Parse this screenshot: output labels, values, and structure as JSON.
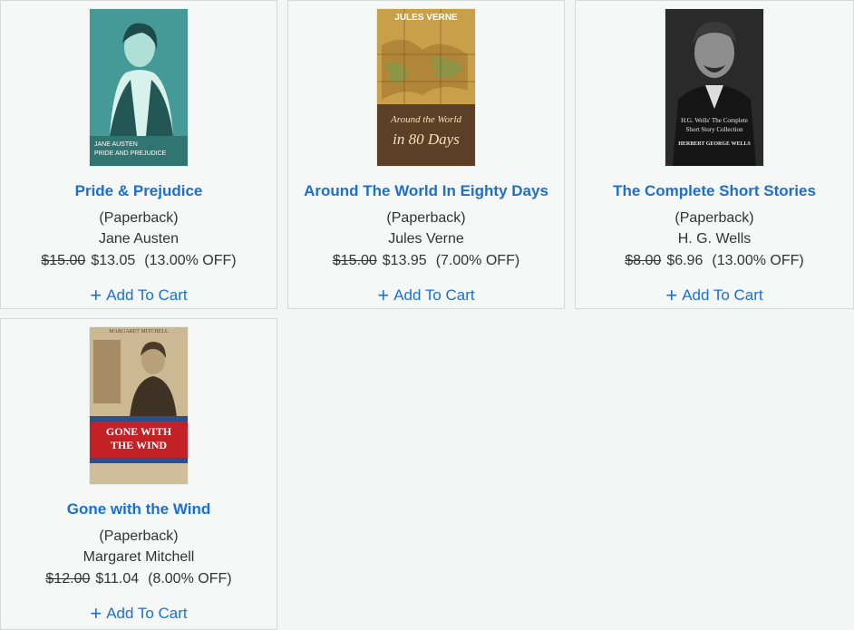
{
  "books": [
    {
      "title": "Pride & Prejudice",
      "format": "(Paperback)",
      "author": "Jane Austen",
      "old_price": "$15.00",
      "new_price": "$13.05",
      "discount": "(13.00% OFF)",
      "cover_text_1": "JANE AUSTEN",
      "cover_text_2": "PRIDE AND PREJUDICE",
      "add_to_cart": "Add To Cart"
    },
    {
      "title": "Around The World In Eighty Days",
      "format": "(Paperback)",
      "author": "Jules Verne",
      "old_price": "$15.00",
      "new_price": "$13.95",
      "discount": "(7.00% OFF)",
      "cover_text_1": "JULES VERNE",
      "cover_text_2": "Around the World",
      "cover_text_3": "in 80 Days",
      "add_to_cart": "Add To Cart"
    },
    {
      "title": "The Complete Short Stories",
      "format": "(Paperback)",
      "author": "H. G. Wells",
      "old_price": "$8.00",
      "new_price": "$6.96",
      "discount": "(13.00% OFF)",
      "cover_text_1": "H.G. Wells' The Complete",
      "cover_text_2": "Short Story Collection",
      "cover_text_3": "HERBERT GEORGE WELLS",
      "add_to_cart": "Add To Cart"
    },
    {
      "title": "Gone with the Wind",
      "format": "(Paperback)",
      "author": "Margaret Mitchell",
      "old_price": "$12.00",
      "new_price": "$11.04",
      "discount": "(8.00% OFF)",
      "cover_text_1": "MARGARET MITCHELL",
      "cover_text_2": "GONE WITH",
      "cover_text_3": "THE WIND",
      "add_to_cart": "Add To Cart"
    }
  ],
  "colors": {
    "link": "#1a6fd6",
    "text": "#333333",
    "card_bg": "#f6f8f7",
    "border": "#d6d9d8"
  },
  "icons": {
    "add": "plus-icon"
  }
}
